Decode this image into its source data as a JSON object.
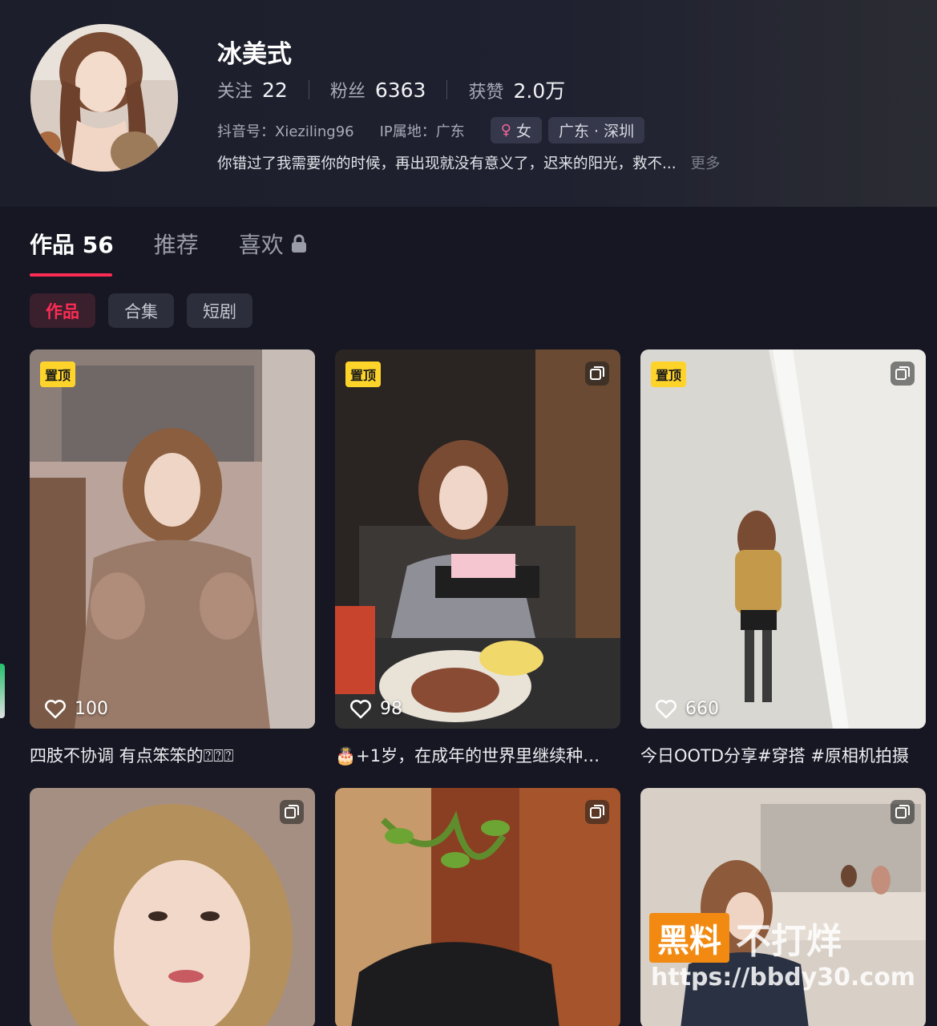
{
  "profile": {
    "username": "冰美式",
    "stats": [
      {
        "label": "关注",
        "value": "22"
      },
      {
        "label": "粉丝",
        "value": "6363"
      },
      {
        "label": "获赞",
        "value": "2.0万"
      }
    ],
    "douyin_id": "抖音号：Xieziling96",
    "ip_location": "IP属地：广东",
    "gender_tag": "女",
    "location_tag": "广东 · 深圳",
    "bio": "你错过了我需要你的时候，再出现就没有意义了，迟来的阳光，救不...",
    "more_label": "更多"
  },
  "tabs": [
    {
      "label": "作品 56",
      "active": true
    },
    {
      "label": "推荐",
      "active": false
    },
    {
      "label": "喜欢",
      "active": false,
      "locked": true
    }
  ],
  "chips": [
    {
      "label": "作品",
      "active": true
    },
    {
      "label": "合集",
      "active": false
    },
    {
      "label": "短剧",
      "active": false
    }
  ],
  "pin_label": "置顶",
  "videos": [
    {
      "caption": "四肢不协调 有点笨笨的⍰⍰⍰",
      "likes": "100",
      "pinned": true,
      "multi": false
    },
    {
      "caption": "🎂+1岁，在成年的世界里继续种…",
      "likes": "98",
      "pinned": true,
      "multi": true
    },
    {
      "caption": "今日OOTD分享#穿搭 #原相机拍摄",
      "likes": "660",
      "pinned": true,
      "multi": true
    },
    {
      "caption": "",
      "likes": "",
      "pinned": false,
      "multi": true
    },
    {
      "caption": "",
      "likes": "",
      "pinned": false,
      "multi": true
    },
    {
      "caption": "",
      "likes": "",
      "pinned": false,
      "multi": true
    }
  ],
  "watermark": {
    "brand_box": "黑料",
    "brand_text": "不打烊",
    "url": "https://bbdy30.com"
  },
  "colors": {
    "accent": "#fe2c55",
    "pin_badge": "#ffd42a",
    "background": "#161722"
  }
}
